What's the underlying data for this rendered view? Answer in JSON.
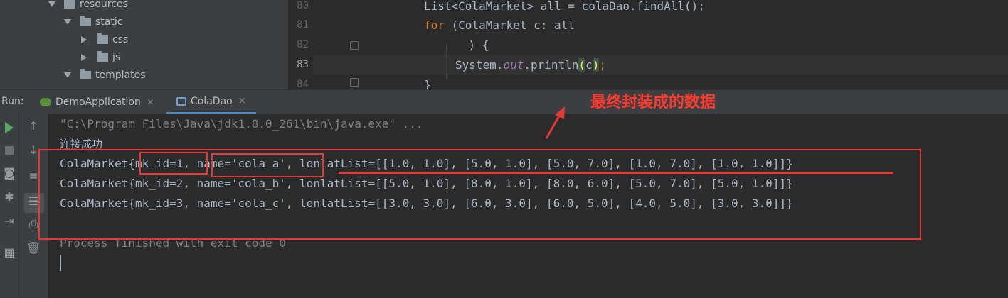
{
  "project_tree": {
    "items": [
      {
        "label": "resources",
        "expanded": true
      },
      {
        "label": "static",
        "expanded": true
      },
      {
        "label": "css",
        "expanded": false
      },
      {
        "label": "js",
        "expanded": false
      },
      {
        "label": "templates",
        "expanded": true
      }
    ]
  },
  "editor": {
    "line_numbers": [
      "80",
      "81",
      "82",
      "83",
      "84"
    ],
    "lines": {
      "l80": "List<ColaMarket> all = colaDao.findAll();",
      "l81_kw": "for",
      "l81_rest": " (ColaMarket c: all",
      "l82": "    ) {",
      "l83_a": "System.",
      "l83_fld": "out",
      "l83_b": ".println",
      "l83_paren_open": "(",
      "l83_arg": "c",
      "l83_paren_close": ")",
      "l83_end": ";",
      "l84": "}"
    }
  },
  "run_panel": {
    "label": "Run:",
    "tabs": [
      {
        "label": "DemoApplication",
        "close": "×"
      },
      {
        "label": "ColaDao",
        "close": "×"
      }
    ]
  },
  "console": {
    "lines": [
      "\"C:\\Program Files\\Java\\jdk1.8.0_261\\bin\\java.exe\" ...",
      "连接成功",
      "ColaMarket{mk_id=1, name='cola_a', lonlatList=[[1.0, 1.0], [5.0, 1.0], [5.0, 7.0], [1.0, 7.0], [1.0, 1.0]]}",
      "ColaMarket{mk_id=2, name='cola_b', lonlatList=[[5.0, 1.0], [8.0, 1.0], [8.0, 6.0], [5.0, 7.0], [5.0, 1.0]]}",
      "ColaMarket{mk_id=3, name='cola_c', lonlatList=[[3.0, 3.0], [6.0, 3.0], [6.0, 5.0], [4.0, 5.0], [3.0, 3.0]]}",
      "",
      "Process finished with exit code 0"
    ]
  },
  "annotation": {
    "text": "最终封装成的数据",
    "color": "#e53935"
  }
}
